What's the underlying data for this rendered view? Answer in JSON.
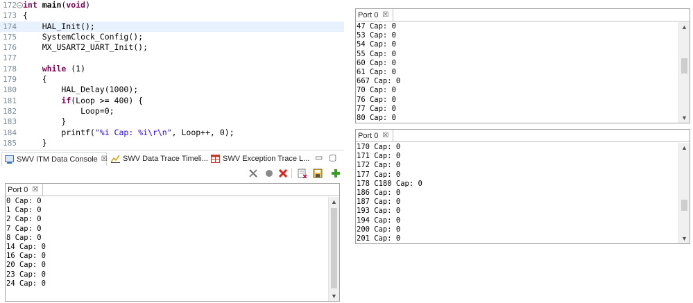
{
  "editor": {
    "lines": [
      {
        "num": "172",
        "parts": [
          [
            "kw",
            "int"
          ],
          [
            "t",
            " "
          ],
          [
            "fn",
            "main"
          ],
          [
            "t",
            "("
          ],
          [
            "kw",
            "void"
          ],
          [
            "t",
            ")"
          ]
        ],
        "fold": true
      },
      {
        "num": "173",
        "parts": [
          [
            "t",
            "{"
          ]
        ]
      },
      {
        "num": "174",
        "parts": [
          [
            "t",
            "    HAL_Init();"
          ]
        ],
        "highlight": true
      },
      {
        "num": "175",
        "parts": [
          [
            "t",
            "    SystemClock_Config();"
          ]
        ]
      },
      {
        "num": "176",
        "parts": [
          [
            "t",
            "    MX_USART2_UART_Init();"
          ]
        ]
      },
      {
        "num": "177",
        "parts": [
          [
            "t",
            ""
          ]
        ]
      },
      {
        "num": "178",
        "parts": [
          [
            "t",
            "    "
          ],
          [
            "kw",
            "while"
          ],
          [
            "t",
            " (1)"
          ]
        ]
      },
      {
        "num": "179",
        "parts": [
          [
            "t",
            "    {"
          ]
        ]
      },
      {
        "num": "180",
        "parts": [
          [
            "t",
            "        HAL_Delay(1000);"
          ]
        ]
      },
      {
        "num": "181",
        "parts": [
          [
            "t",
            "        "
          ],
          [
            "kw",
            "if"
          ],
          [
            "t",
            "(Loop >= 400) {"
          ]
        ]
      },
      {
        "num": "182",
        "parts": [
          [
            "t",
            "            Loop=0;"
          ]
        ]
      },
      {
        "num": "183",
        "parts": [
          [
            "t",
            "        }"
          ]
        ]
      },
      {
        "num": "184",
        "parts": [
          [
            "t",
            "        printf("
          ],
          [
            "str",
            "\"%i Cap: %i\\r\\n\""
          ],
          [
            "t",
            ", Loop++, 0);"
          ]
        ]
      },
      {
        "num": "185",
        "parts": [
          [
            "t",
            "    }"
          ]
        ]
      }
    ]
  },
  "tabs": {
    "itm_console": "SWV ITM Data Console",
    "data_trace": "SWV Data Trace Timeli...",
    "exception_trace": "SWV Exception Trace L..."
  },
  "toolbar_icons": [
    "settings-icon",
    "record-icon",
    "stop-icon",
    "clear-icon",
    "save-icon",
    "add-icon"
  ],
  "consoles": {
    "main": {
      "tab": "Port 0",
      "lines": [
        "0 Cap: 0",
        "1 Cap: 0",
        "2 Cap: 0",
        "7 Cap: 0",
        "8 Cap: 0",
        "14 Cap: 0",
        "16 Cap: 0",
        "20 Cap: 0",
        "23 Cap: 0",
        "24 Cap: 0"
      ]
    },
    "top_right": {
      "tab": "Port 0",
      "lines": [
        "47 Cap: 0",
        "53 Cap: 0",
        "54 Cap: 0",
        "55 Cap: 0",
        "60 Cap: 0",
        "61 Cap: 0",
        "667 Cap: 0",
        "70 Cap: 0",
        "76 Cap: 0",
        "77 Cap: 0",
        "80 Cap: 0"
      ]
    },
    "bottom_right": {
      "tab": "Port 0",
      "lines": [
        "170 Cap: 0",
        "171 Cap: 0",
        "172 Cap: 0",
        "177 Cap: 0",
        "178 C180 Cap: 0",
        "186 Cap: 0",
        "187 Cap: 0",
        "193 Cap: 0",
        "194 Cap: 0",
        "200 Cap: 0",
        "201 Cap: 0"
      ]
    }
  },
  "colors": {
    "keyword": "#7f0055",
    "string": "#2a00ff",
    "highlight_line": "#e8f2fe",
    "stop_red": "#d9261c",
    "add_green": "#3a9d23"
  }
}
